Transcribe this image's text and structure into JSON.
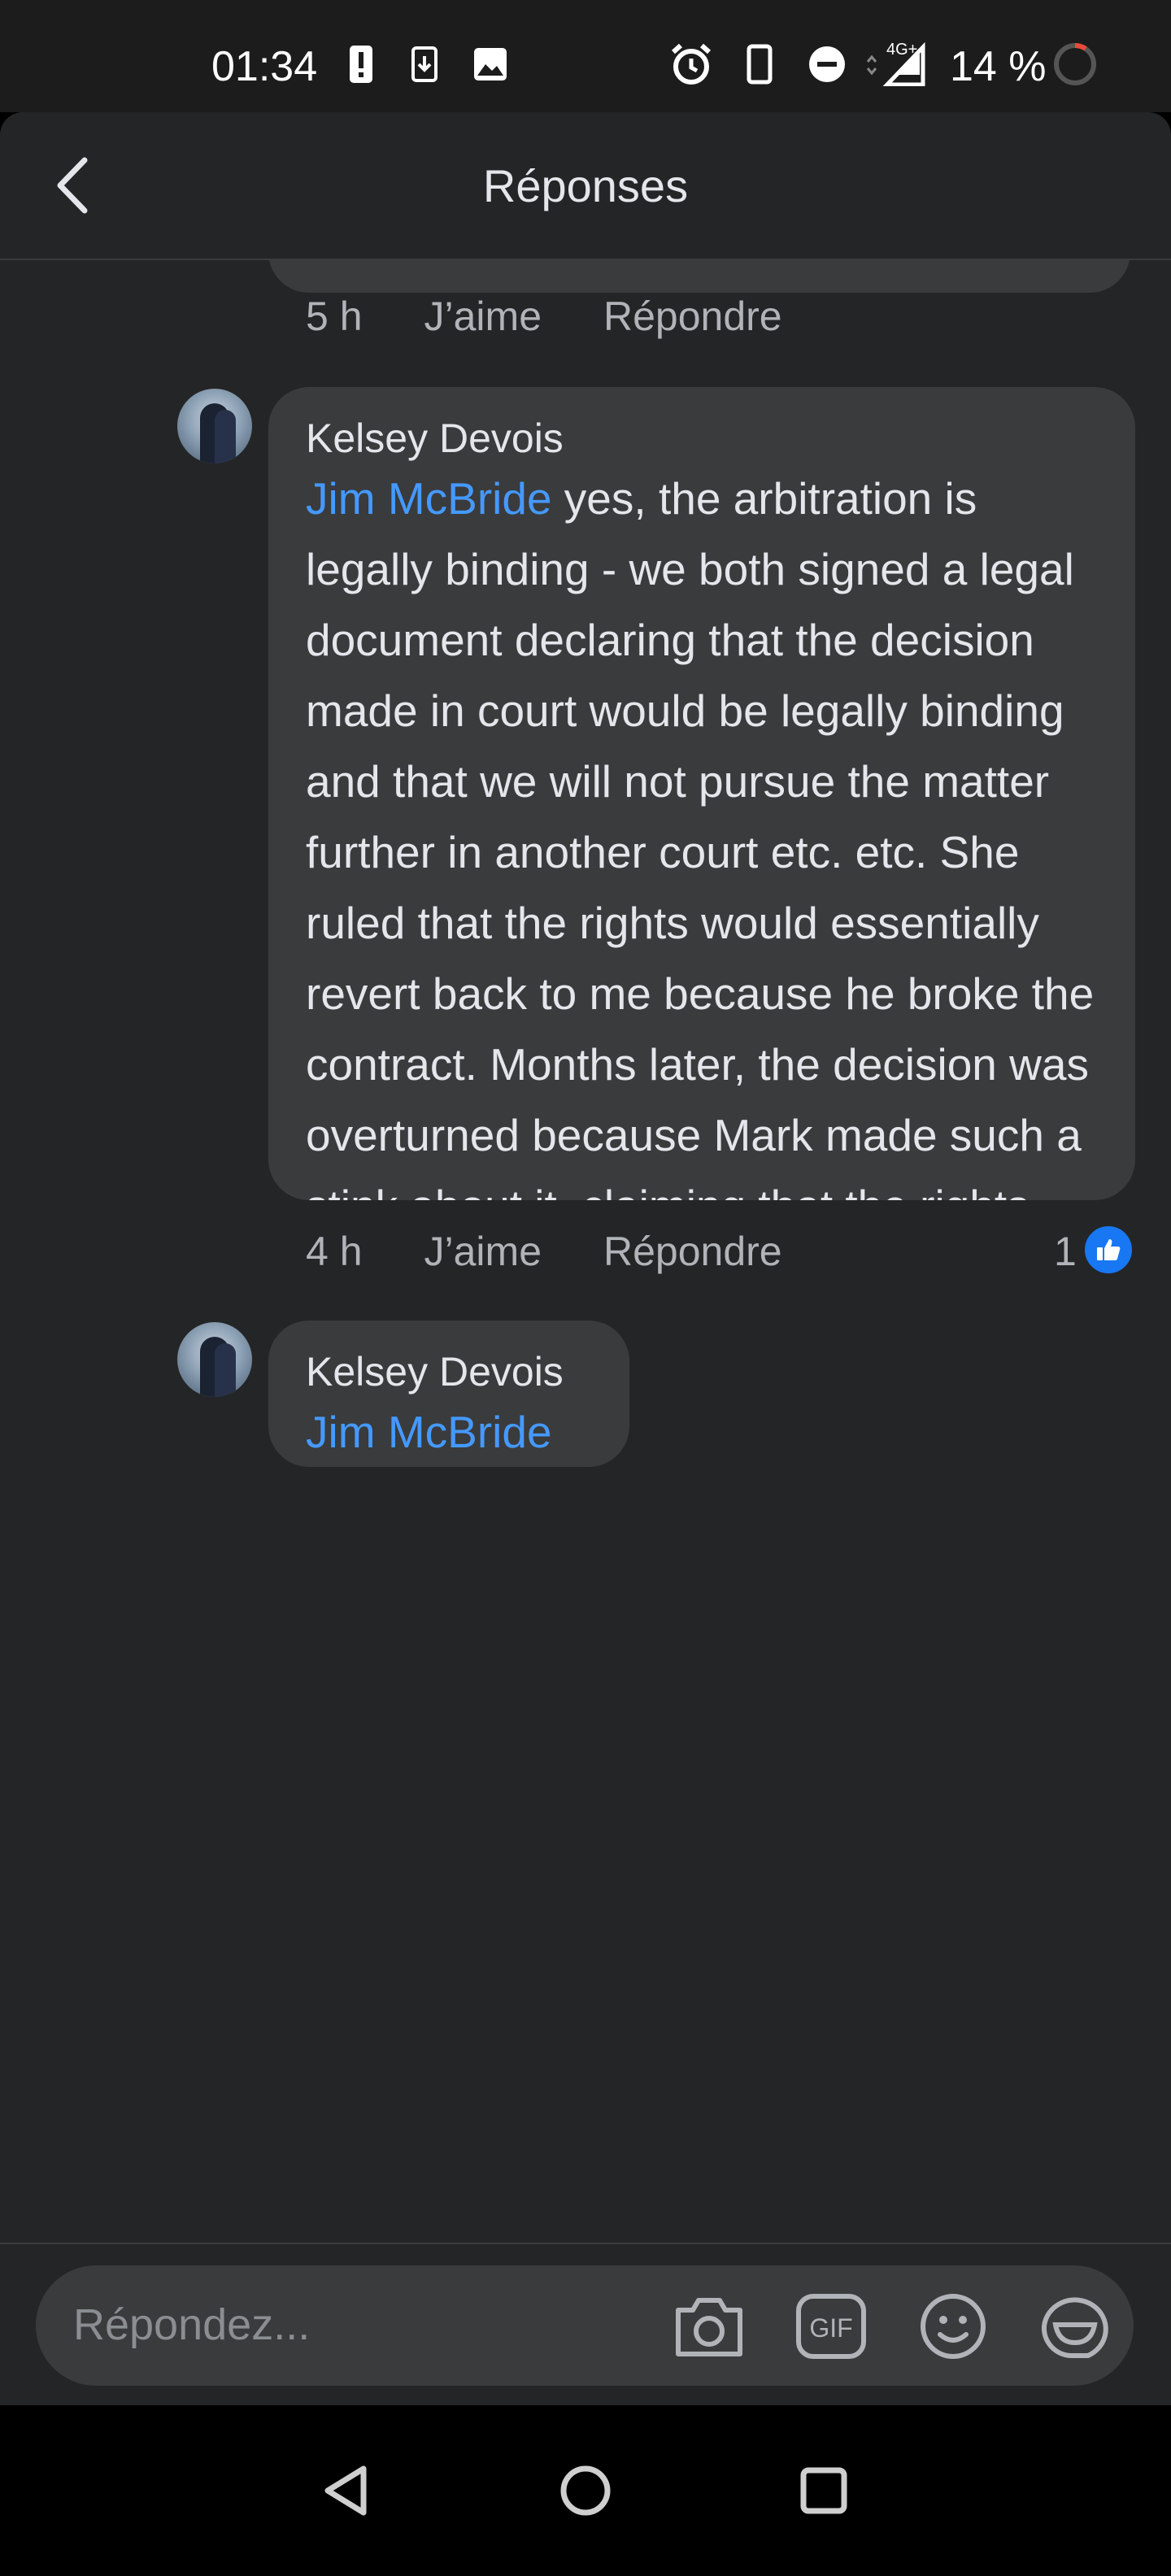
{
  "status_bar": {
    "time": "01:34",
    "network": "4G+",
    "battery_percent": "14 %",
    "icons": [
      "alert-icon",
      "download-icon",
      "image-icon",
      "alarm-icon",
      "phone-icon",
      "dnd-icon",
      "signal-icon",
      "battery-ring-icon"
    ]
  },
  "header": {
    "title": "Réponses",
    "back_icon": "back-chevron-icon"
  },
  "previous_comment": {
    "time": "5 h",
    "like_label": "J’aime",
    "reply_label": "Répondre"
  },
  "comments": [
    {
      "author": "Kelsey Devois",
      "mention": "Jim McBride",
      "text": " yes, the arbitration is legally binding - we both signed a legal document declaring that the decision made in court would be legally binding and that we will not pursue the matter further in another court etc. etc. She ruled that the rights would essentially revert back to me because he broke the contract. Months later, the decision was overturned because Mark made such a stink about it, claiming that the rights weren’t part of my original suit. She fell back on her decision, providing me another legal document saying that it wasn’t within her jurisdiction to grant me those rights back, but that any major court would see that due to his breach of contract, the rights are essentially all mine. I will post the document if I can find it!",
      "time": "4 h",
      "like_label": "J’aime",
      "reply_label": "Répondre",
      "reaction_count": "1",
      "reaction_icon": "thumbs-up-icon"
    },
    {
      "author": "Kelsey Devois",
      "mention": "Jim McBride"
    }
  ],
  "composer": {
    "placeholder": "Répondez...",
    "icons": [
      "camera-icon",
      "gif-icon",
      "emoji-icon",
      "sticker-icon"
    ]
  },
  "navbar": {
    "icons": [
      "back-triangle-icon",
      "home-circle-icon",
      "recents-square-icon"
    ]
  },
  "colors": {
    "mention": "#4599ff",
    "bubble": "#3a3b3c",
    "surface": "#242526",
    "like_blue": "#1877f2"
  }
}
